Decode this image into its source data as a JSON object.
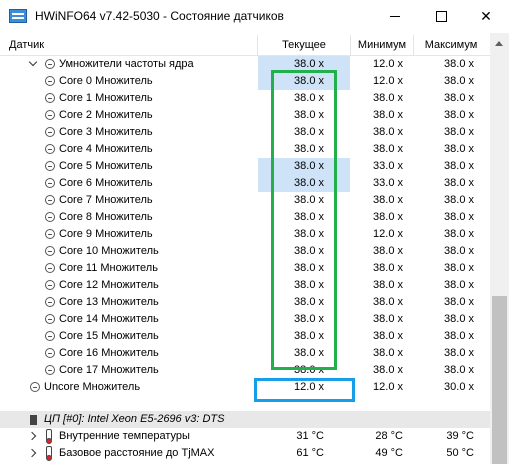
{
  "window": {
    "title": "HWiNFO64 v7.42-5030 - Состояние датчиков"
  },
  "columns": {
    "sensor": "Датчик",
    "current": "Текущее",
    "min": "Минимум",
    "max": "Максимум"
  },
  "rows": [
    {
      "label": "Умножители частоты ядра",
      "current": "38.0 x",
      "min": "12.0 x",
      "max": "38.0 x"
    },
    {
      "label": "Core 0 Множитель",
      "current": "38.0 x",
      "min": "12.0 x",
      "max": "38.0 x"
    },
    {
      "label": "Core 1 Множитель",
      "current": "38.0 x",
      "min": "38.0 x",
      "max": "38.0 x"
    },
    {
      "label": "Core 2 Множитель",
      "current": "38.0 x",
      "min": "38.0 x",
      "max": "38.0 x"
    },
    {
      "label": "Core 3 Множитель",
      "current": "38.0 x",
      "min": "38.0 x",
      "max": "38.0 x"
    },
    {
      "label": "Core 4 Множитель",
      "current": "38.0 x",
      "min": "38.0 x",
      "max": "38.0 x"
    },
    {
      "label": "Core 5 Множитель",
      "current": "38.0 x",
      "min": "33.0 x",
      "max": "38.0 x"
    },
    {
      "label": "Core 6 Множитель",
      "current": "38.0 x",
      "min": "33.0 x",
      "max": "38.0 x"
    },
    {
      "label": "Core 7 Множитель",
      "current": "38.0 x",
      "min": "38.0 x",
      "max": "38.0 x"
    },
    {
      "label": "Core 8 Множитель",
      "current": "38.0 x",
      "min": "38.0 x",
      "max": "38.0 x"
    },
    {
      "label": "Core 9 Множитель",
      "current": "38.0 x",
      "min": "12.0 x",
      "max": "38.0 x"
    },
    {
      "label": "Core 10 Множитель",
      "current": "38.0 x",
      "min": "38.0 x",
      "max": "38.0 x"
    },
    {
      "label": "Core 11 Множитель",
      "current": "38.0 x",
      "min": "38.0 x",
      "max": "38.0 x"
    },
    {
      "label": "Core 12 Множитель",
      "current": "38.0 x",
      "min": "38.0 x",
      "max": "38.0 x"
    },
    {
      "label": "Core 13 Множитель",
      "current": "38.0 x",
      "min": "38.0 x",
      "max": "38.0 x"
    },
    {
      "label": "Core 14 Множитель",
      "current": "38.0 x",
      "min": "38.0 x",
      "max": "38.0 x"
    },
    {
      "label": "Core 15 Множитель",
      "current": "38.0 x",
      "min": "38.0 x",
      "max": "38.0 x"
    },
    {
      "label": "Core 16 Множитель",
      "current": "38.0 x",
      "min": "38.0 x",
      "max": "38.0 x"
    },
    {
      "label": "Core 17 Множитель",
      "current": "38.0 x",
      "min": "38.0 x",
      "max": "38.0 x"
    },
    {
      "label": "Uncore Множитель",
      "current": "12.0 x",
      "min": "12.0 x",
      "max": "30.0 x"
    }
  ],
  "group": {
    "label": "ЦП [#0]: Intel Xeon E5-2696 v3: DTS"
  },
  "group_rows": [
    {
      "label": "Внутренние температуры",
      "current": "31 °C",
      "min": "28 °C",
      "max": "39 °C"
    },
    {
      "label": "Базовое расстояние до TjMAX",
      "current": "61 °C",
      "min": "49 °C",
      "max": "50 °C"
    }
  ]
}
